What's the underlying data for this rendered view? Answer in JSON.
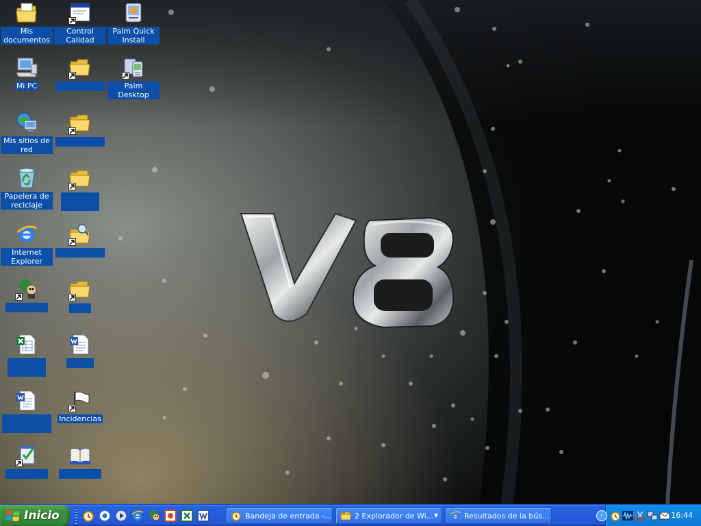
{
  "desktop": {
    "icons": [
      {
        "label": "Mis documentos",
        "icon": "my-documents-icon"
      },
      {
        "label": "Control Calidad",
        "icon": "window-app-icon"
      },
      {
        "label": "Palm Quick Install",
        "icon": "palm-install-icon"
      },
      {
        "label": "Mi PC",
        "icon": "my-computer-icon"
      },
      {
        "label": "",
        "icon": "folder-icon"
      },
      {
        "label": "Palm Desktop",
        "icon": "palm-desktop-icon"
      },
      {
        "label": "Mis sitios de red",
        "icon": "network-places-icon"
      },
      {
        "label": "",
        "icon": "folder-icon"
      },
      {
        "label": "Papelera de reciclaje",
        "icon": "recycle-bin-icon"
      },
      {
        "label": "",
        "icon": "folder-icon"
      },
      {
        "label": "Internet Explorer",
        "icon": "internet-explorer-icon"
      },
      {
        "label": "",
        "icon": "folder-search-icon"
      },
      {
        "label": "",
        "icon": "game-character-icon"
      },
      {
        "label": "",
        "icon": "folder-icon"
      },
      {
        "label": "",
        "icon": "excel-document-icon"
      },
      {
        "label": "",
        "icon": "word-document-icon"
      },
      {
        "label": "",
        "icon": "word-document-icon"
      },
      {
        "label": "Incidencias",
        "icon": "flag-icon"
      },
      {
        "label": "",
        "icon": "checklist-icon"
      },
      {
        "label": "",
        "icon": "open-book-icon"
      }
    ]
  },
  "taskbar": {
    "start_label": "Inicio",
    "quick_launch": [
      "alarm-clock-icon",
      "ie-circle-icon",
      "media-player-icon",
      "internet-explorer-icon",
      "game-character-icon",
      "powerpoint-icon",
      "excel-icon",
      "word-icon"
    ],
    "tasks": [
      {
        "label": "Bandeja de entrada -...",
        "icon": "alarm-clock-icon"
      },
      {
        "label": "2 Explorador de Wi...",
        "icon": "folder-icon"
      },
      {
        "label": "Resultados de la bús...",
        "icon": "internet-explorer-icon"
      }
    ],
    "tray_icons": [
      "alarm-clock-icon",
      "audio-wave-icon",
      "scissors-icon",
      "network-icon",
      "mail-icon"
    ],
    "clock": "16:44"
  }
}
